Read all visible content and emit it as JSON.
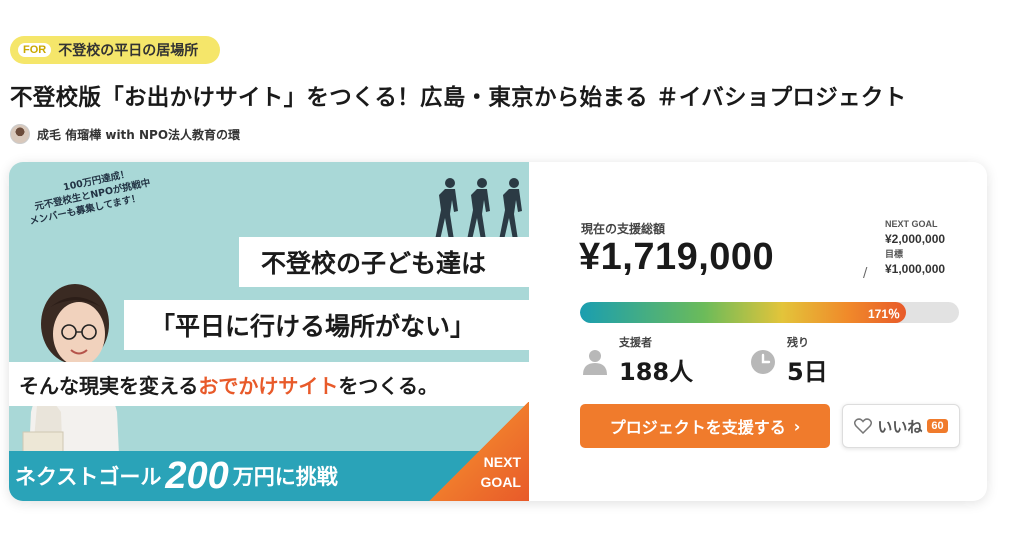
{
  "tag": {
    "prefix": "FOR",
    "label": "不登校の平日の居場所"
  },
  "title": "不登校版「お出かけサイト」をつくる！広島・東京から始まる ＃イバショプロジェクト",
  "author": {
    "name": "成毛 侑瑠樺 with NPO法人教育の環"
  },
  "banner": {
    "speech": [
      "100万円達成！",
      "元不登校生とNPOが挑戦中",
      "メンバーも募集してます！"
    ],
    "line1": "不登校の子ども達は",
    "line2": "「平日に行ける場所がない」",
    "line3_a": "そんな現実を変える",
    "line3_hl": "おでかけサイト",
    "line3_b": "をつくる。",
    "goal_a": "ネクストゴール",
    "goal_num": "200",
    "goal_b": "万円に挑戦",
    "next1": "NEXT",
    "next2": "GOAL"
  },
  "funding": {
    "current_label": "現在の支援総額",
    "amount": "¥1,719,000",
    "separator": "/",
    "next_goal_label": "NEXT GOAL",
    "next_goal_value": "¥2,000,000",
    "goal_label": "目標",
    "goal_value": "¥1,000,000",
    "percent_text": "171％",
    "progress_fraction": 0.86
  },
  "stats": {
    "supporters_label": "支援者",
    "supporters_value": "188人",
    "remaining_label": "残り",
    "remaining_value": "5日"
  },
  "actions": {
    "support_label": "プロジェクトを支援する",
    "support_chevron": "›",
    "like_label": "いいね",
    "like_count": "60"
  },
  "colors": {
    "accent": "#f07b2c",
    "tag_bg": "#f5e66a",
    "banner_bg": "#a9d8d7",
    "goal_bar": "#2aa3b8"
  }
}
